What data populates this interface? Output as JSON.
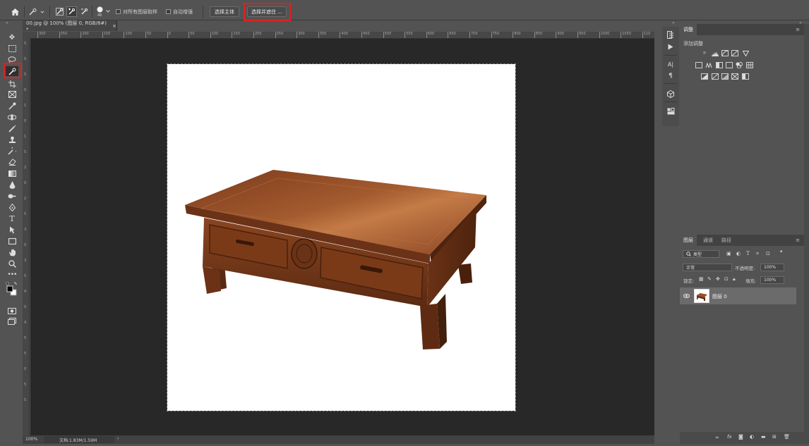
{
  "options_bar": {
    "brush_size": "46",
    "sample_all_layers_label": "对所有图层取样",
    "auto_enhance_label": "自动增强",
    "select_subject_label": "选择主体",
    "select_and_mask_label": "选择并遮住 ..."
  },
  "document": {
    "tab_title": "00.jpg @ 100% (图层 0, RGB/8#) *",
    "tab_close": "×",
    "zoom": "100%",
    "doc_info": "文档:1.83M/1.59M",
    "status_arrow": "›"
  },
  "ruler": {
    "h_ticks": [
      "300",
      "250",
      "200",
      "150",
      "100",
      "50",
      "0",
      "50",
      "100",
      "150",
      "200",
      "250",
      "300",
      "350",
      "400",
      "450",
      "500",
      "550",
      "600",
      "650",
      "700",
      "750",
      "800",
      "850",
      "900",
      "950",
      "1000",
      "1050",
      "110"
    ],
    "v_ticks": [
      "5",
      "0",
      "5",
      "0",
      "1",
      "0",
      "1",
      "5",
      "2",
      "0",
      "2",
      "5",
      "3",
      "0",
      "3",
      "5",
      "4",
      "0",
      "4",
      "5",
      "5",
      "0",
      "5",
      "5"
    ]
  },
  "adjustments_panel": {
    "tab": "调整",
    "add_adjustment": "添加调整"
  },
  "layers_panel": {
    "tabs": [
      "图层",
      "通道",
      "路径"
    ],
    "filter_kind": "类型",
    "blend_mode": "正常",
    "opacity_label": "不透明度:",
    "opacity_value": "100%",
    "lock_label": "锁定:",
    "fill_label": "填充:",
    "fill_value": "100%",
    "layer_name": "图层 0"
  },
  "icons": {
    "home": "home-icon",
    "quick_select": "quick-selection-icon",
    "move": "move-icon",
    "marquee": "marquee-icon",
    "lasso": "lasso-icon",
    "eye": "eye-icon"
  }
}
